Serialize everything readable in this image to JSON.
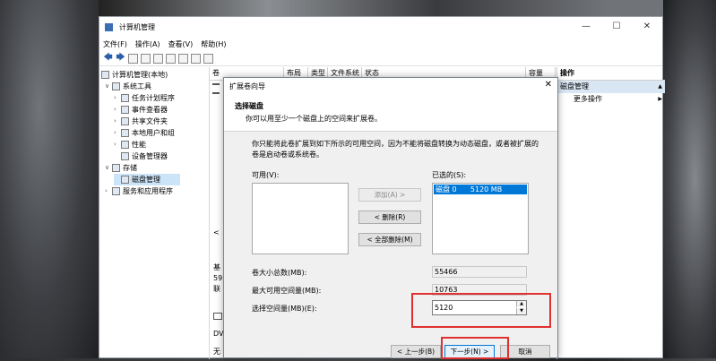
{
  "window": {
    "title": "计算机管理",
    "minimize": "—",
    "maximize": "☐",
    "close": "✕"
  },
  "menu": [
    "文件(F)",
    "操作(A)",
    "查看(V)",
    "帮助(H)"
  ],
  "toolbar": {
    "back": "🡄",
    "forward": "🡆"
  },
  "tree": {
    "root": "计算机管理(本地)",
    "system_tools": "系统工具",
    "task_scheduler": "任务计划程序",
    "event_viewer": "事件查看器",
    "shared_folders": "共享文件夹",
    "local_users": "本地用户和组",
    "performance": "性能",
    "device_manager": "设备管理器",
    "storage": "存储",
    "disk_management": "磁盘管理",
    "services": "服务和应用程序"
  },
  "columns": [
    "卷",
    "布局",
    "类型",
    "文件系统",
    "状态",
    "容量"
  ],
  "left_fragments": {
    "a": "基",
    "b": "59",
    "c": "联",
    "d": "DV",
    "e": "无",
    "f": "<"
  },
  "actions": {
    "header": "操作",
    "section": "磁盘管理",
    "section_arrow": "▲",
    "more": "更多操作",
    "more_arrow": "▶"
  },
  "wizard": {
    "title": "扩展卷向导",
    "close": "✕",
    "heading": "选择磁盘",
    "subheading": "你可以用至少一个磁盘上的空间来扩展卷。",
    "description": "你只能将此卷扩展到如下所示的可用空间，因为不能将磁盘转换为动态磁盘，或者被扩展的卷是启动卷或系统卷。",
    "available_label": "可用(V):",
    "selected_label": "已选的(S):",
    "selected_items": [
      "磁盘 0      5120 MB"
    ],
    "add_button": "添加(A) >",
    "remove_button": "< 删除(R)",
    "remove_all_button": "< 全部删除(M)",
    "total_size_label": "卷大小总数(MB):",
    "total_size_value": "55466",
    "max_space_label": "最大可用空间量(MB):",
    "max_space_value": "10763",
    "select_space_label": "选择空间量(MB)(E):",
    "select_space_value": "5120",
    "back_button": "< 上一步(B)",
    "next_button": "下一步(N) >",
    "cancel_button": "取消"
  }
}
